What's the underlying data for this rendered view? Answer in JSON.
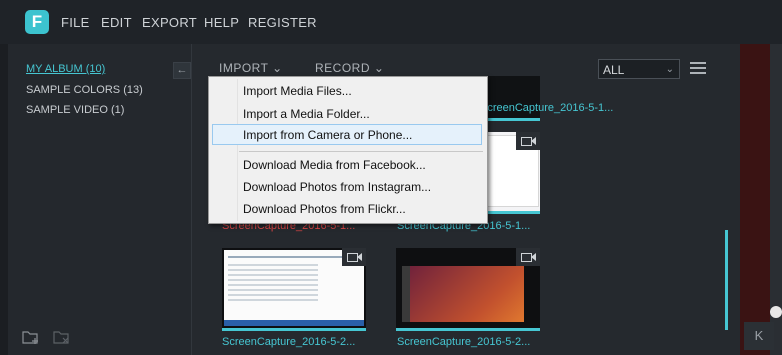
{
  "app": {
    "logo_letter": "F",
    "accent": "#46c6d2"
  },
  "menu": [
    "FILE",
    "EDIT",
    "EXPORT",
    "HELP",
    "REGISTER"
  ],
  "sidebar": {
    "items": [
      {
        "label": "MY ALBUM (10)",
        "active": true
      },
      {
        "label": "SAMPLE COLORS (13)",
        "active": false
      },
      {
        "label": "SAMPLE VIDEO (1)",
        "active": false
      }
    ],
    "collapse_icon": "←"
  },
  "toolbar": {
    "import_label": "IMPORT",
    "record_label": "RECORD",
    "filter_value": "ALL",
    "chevron": "⌄"
  },
  "import_menu": {
    "items": [
      "Import Media Files...",
      "Import a Media Folder...",
      "Import from Camera or Phone...",
      "Download Media from Facebook...",
      "Download Photos from Instagram...",
      "Download Photos from Flickr..."
    ],
    "highlighted_index": 2
  },
  "media": [
    {
      "caption": "ScreenCapture_2016-5-1...",
      "color": "#46c6d2"
    },
    {
      "caption": "ScreenCapture_2016-5-1...",
      "color": "#d64545"
    },
    {
      "caption": "ScreenCapture_2016-5-1...",
      "color": "#46c6d2"
    },
    {
      "caption": "ScreenCapture_2016-5-2...",
      "color": "#46c6d2"
    },
    {
      "caption": "ScreenCapture_2016-5-2...",
      "color": "#46c6d2"
    }
  ],
  "right_panel": {
    "button_label": "K"
  }
}
